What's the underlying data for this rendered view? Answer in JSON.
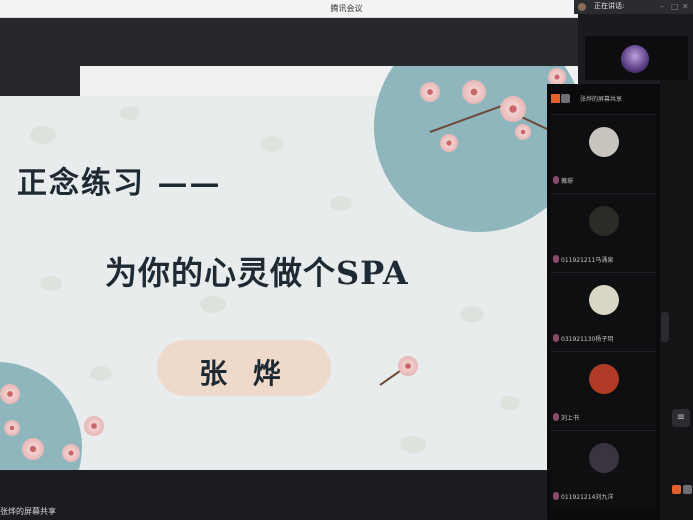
{
  "window": {
    "title": "腾讯会议"
  },
  "speaking": {
    "label": "正在讲话:"
  },
  "slide": {
    "title_line1": "正念练习 ——",
    "title_line2": "为你的心灵做个SPA",
    "presenter": "张 烨"
  },
  "share_label": "张烨的屏幕共享",
  "panel": {
    "header": "张烨的屏幕共享",
    "participants": [
      {
        "name": "薇璟",
        "avatar_color": "#c9c4bd"
      },
      {
        "name": "011921211马涌泉",
        "avatar_color": "#2d2b26"
      },
      {
        "name": "031921130杨子玥",
        "avatar_color": "#d9d6c6"
      },
      {
        "name": "刘上书",
        "avatar_color": "#b03a25"
      },
      {
        "name": "011921214刘九洋",
        "avatar_color": "#3a3440"
      }
    ]
  },
  "colors": {
    "accent": "#e2612d",
    "slide_bg": "#e8ecec",
    "circle": "#8fb5bd",
    "pill": "#eed9ca"
  },
  "icons": [
    "minimize-icon",
    "maximize-icon",
    "close-icon",
    "list-icon",
    "mic-icon"
  ]
}
